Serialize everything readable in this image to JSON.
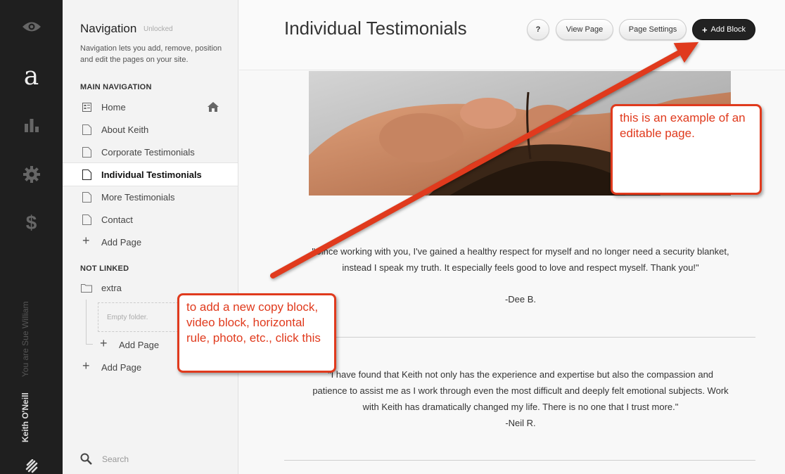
{
  "rail": {
    "user_name": "Keith O'Neill",
    "you_are": "You are Sue William",
    "logo_letter": "a",
    "icons": [
      "eye-icon",
      "logo-icon",
      "analytics-icon",
      "gear-icon",
      "dollar-icon",
      "squarespace-logo-icon"
    ]
  },
  "nav": {
    "title": "Navigation",
    "lock_status": "Unlocked",
    "description": "Navigation lets you add, remove, position and edit the pages on your site.",
    "main_section": "MAIN NAVIGATION",
    "main_items": [
      {
        "label": "Home",
        "icon": "home-page-icon"
      },
      {
        "label": "About Keith",
        "icon": "page-icon"
      },
      {
        "label": "Corporate Testimonials",
        "icon": "page-icon"
      },
      {
        "label": "Individual Testimonials",
        "icon": "page-icon",
        "active": true
      },
      {
        "label": "More Testimonials",
        "icon": "page-icon"
      },
      {
        "label": "Contact",
        "icon": "page-icon"
      }
    ],
    "add_page": "Add Page",
    "not_linked_section": "NOT LINKED",
    "folder_label": "extra",
    "empty_folder": "Empty folder.",
    "folder_add_page": "Add Page",
    "not_linked_add_page": "Add Page",
    "search_placeholder": "Search"
  },
  "main": {
    "title": "Individual Testimonials",
    "help_label": "?",
    "view_page_label": "View Page",
    "page_settings_label": "Page Settings",
    "add_block_label": "Add Block",
    "quotes": [
      {
        "text": "\"Since working with you, I've gained a healthy respect for myself and no longer need a security blanket, instead I speak my truth. It especially feels good to love and respect myself. Thank you!\"",
        "author": "-Dee B."
      },
      {
        "text": "\"I have found that Keith not only has the experience and expertise but also the compassion and patience to assist me as I work through even the most difficult and deeply felt emotional subjects. Work with Keith has dramatically changed my life. There is no one that I trust more.\"",
        "author": "-Neil R."
      }
    ]
  },
  "annotations": {
    "callout_editable": "this is an example of an editable page.",
    "callout_add_block": "to add a new copy block, video block, horizontal rule, photo, etc., click this",
    "color": "#e03a1d"
  }
}
